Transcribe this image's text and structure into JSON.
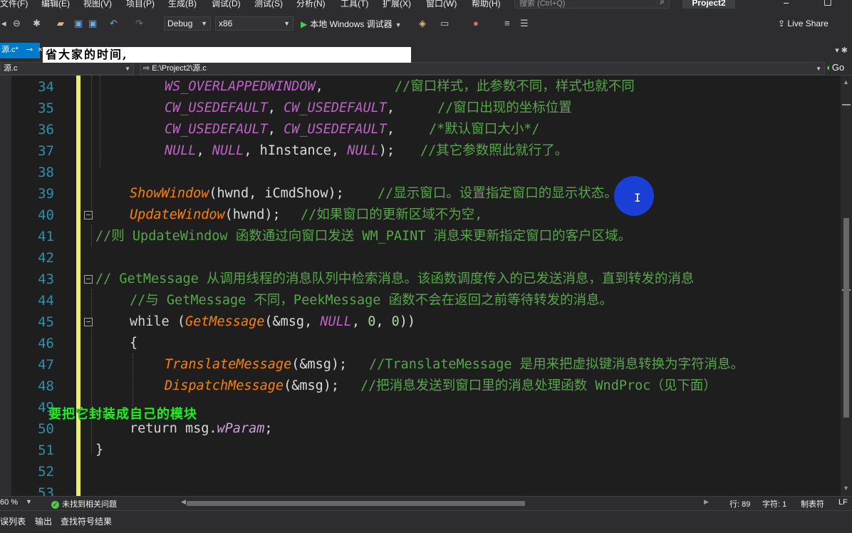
{
  "menu": {
    "items": [
      "文件(F)",
      "编辑(E)",
      "视图(V)",
      "项目(P)",
      "生成(B)",
      "调试(D)",
      "测试(S)",
      "分析(N)",
      "工具(T)",
      "扩展(X)",
      "窗口(W)",
      "帮助(H)"
    ],
    "search_placeholder": "搜索 (Ctrl+Q)",
    "project": "Project2"
  },
  "toolbar": {
    "config": "Debug",
    "platform": "x86",
    "run_label": "本地 Windows 调试器",
    "live_share": "Live Share"
  },
  "tab": {
    "doc_title": "源.c*",
    "caption_overlay": "省大家的时间,"
  },
  "nav": {
    "scope": "源.c",
    "path": "E:\\Project2\\源.c",
    "right_label": "Go"
  },
  "editor": {
    "lines": [
      {
        "num": "34"
      },
      {
        "num": "35"
      },
      {
        "num": "36"
      },
      {
        "num": "37"
      },
      {
        "num": "38"
      },
      {
        "num": "39"
      },
      {
        "num": "40"
      },
      {
        "num": "41"
      },
      {
        "num": "42"
      },
      {
        "num": "43"
      },
      {
        "num": "44"
      },
      {
        "num": "45"
      },
      {
        "num": "46"
      },
      {
        "num": "47"
      },
      {
        "num": "48"
      },
      {
        "num": "49"
      },
      {
        "num": "50"
      },
      {
        "num": "51"
      },
      {
        "num": "52"
      },
      {
        "num": "53"
      }
    ],
    "t": {
      "l34_macro": "WS_OVERLAPPEDWINDOW",
      "l34_rest": ",",
      "l34_cm": "//窗口样式，此参数不同，样式也就不同",
      "l35_m1": "CW_USEDEFAULT",
      "l35_sep": ", ",
      "l35_m2": "CW_USEDEFAULT",
      "l35_rest": ",",
      "l35_cm": "//窗口出现的坐标位置",
      "l36_m1": "CW_USEDEFAULT",
      "l36_sep": ", ",
      "l36_m2": "CW_USEDEFAULT",
      "l36_rest": ",",
      "l36_cm": "/*默认窗口大小*/",
      "l37_m1": "NULL",
      "l37_s1": ", ",
      "l37_m2": "NULL",
      "l37_s2": ", hInstance, ",
      "l37_m3": "NULL",
      "l37_s3": ");",
      "l37_cm": "//其它参数照此就行了。",
      "l39_fn": "ShowWindow",
      "l39_rest": "(hwnd, iCmdShow);",
      "l39_cm": "//显示窗口。设置指定窗口的显示状态。",
      "l40_fn": "UpdateWindow",
      "l40_rest": "(hwnd);",
      "l40_cm": "//如果窗口的更新区域不为空,",
      "l41_cm": "//则 UpdateWindow 函数通过向窗口发送 WM_PAINT 消息来更新指定窗口的客户区域。",
      "l43_cm": "// GetMessage 从调用线程的消息队列中检索消息。该函数调度传入的已发送消息，直到转发的消息",
      "l44_cm": "//与 GetMessage 不同，PeekMessage 函数不会在返回之前等待转发的消息。",
      "l45_kw": "while",
      "l45_p1": " (",
      "l45_fn": "GetMessage",
      "l45_p2": "(&msg, ",
      "l45_m": "NULL",
      "l45_p3": ", ",
      "l45_n1": "0",
      "l45_p4": ", ",
      "l45_n2": "0",
      "l45_p5": "))",
      "l46_brace": "{",
      "l47_fn": "TranslateMessage",
      "l47_rest": "(&msg);",
      "l47_cm": "//TranslateMessage 是用来把虚拟键消息转换为字符消息。",
      "l48_fn": "DispatchMessage",
      "l48_rest": "(&msg);",
      "l48_cm": "//把消息发送到窗口里的消息处理函数 WndProc（见下面）",
      "l50_kw": "return",
      "l50_rest": " msg.",
      "l50_field": "wParam",
      "l50_end": ";",
      "l51_brace": "}"
    },
    "green_caption": "要把它封装成自己的模块"
  },
  "status": {
    "zoom": "60 %",
    "issues": "未找到相关问题",
    "line": "行: 89",
    "char": "字符: 1",
    "tabs": "制表符",
    "eol": "LF"
  },
  "bottom_tabs": [
    "误列表",
    "输出",
    "查找符号结果"
  ]
}
